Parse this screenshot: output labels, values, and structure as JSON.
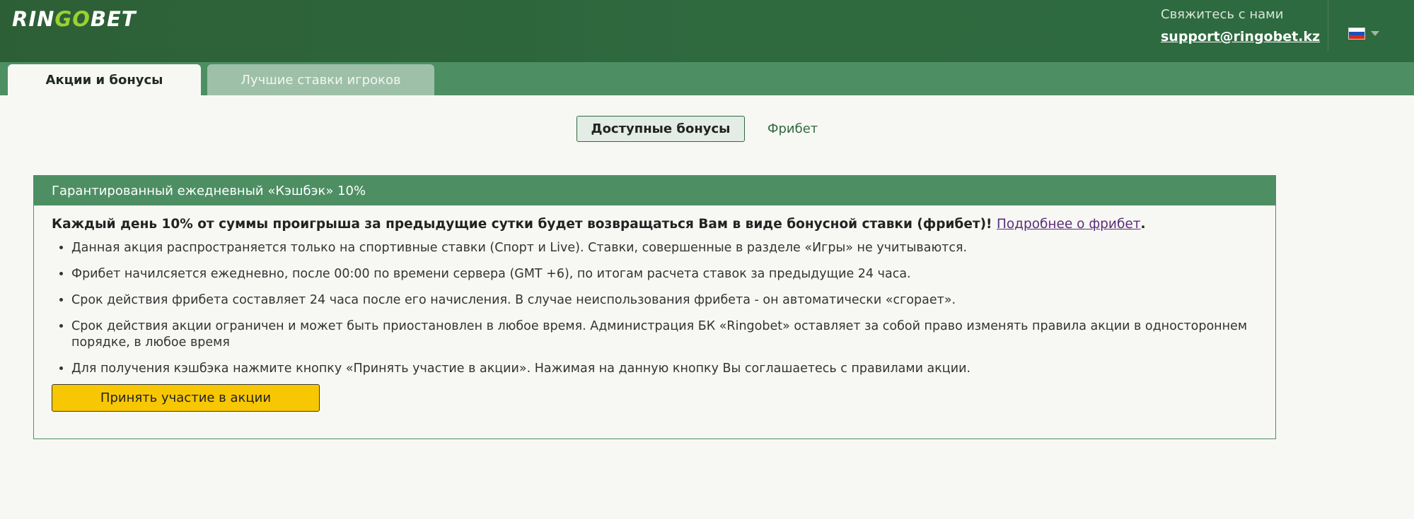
{
  "header": {
    "logo_text_1": "RIN",
    "logo_text_2": "GO",
    "logo_text_3": "BET",
    "contact_label": "Свяжитесь с нами",
    "contact_email": "support@ringobet.kz",
    "language_icon": "flag-ru-icon"
  },
  "tabs": [
    {
      "label": "Акции и бонусы",
      "active": true
    },
    {
      "label": "Лучшие ставки игроков",
      "active": false
    }
  ],
  "subtabs": [
    {
      "label": "Доступные бонусы",
      "active": true
    },
    {
      "label": "Фрибет",
      "active": false
    }
  ],
  "promo": {
    "title": "Гарантированный ежедневный «Кэшбэк» 10%",
    "lead": "Каждый день 10% от суммы проигрыша за предыдущие сутки будет возвращаться Вам в виде бонусной ставки (фрибет)! ",
    "lead_link": "Подробнее о фрибет",
    "lead_tail": ".",
    "rules": [
      "Данная акция распространяется только на спортивные ставки (Спорт и Live). Ставки, совершенные в разделе «Игры» не учитываются.",
      "Фрибет начилсяется ежедневно, после 00:00 по времени сервера (GMT +6), по итогам расчета ставок за предыдущие 24 часа.",
      "Срок действия фрибета составляет 24 часа после его начисления. В случае неиспользования фрибета - он автоматически «сгорает».",
      "Срок действия акции ограничен и может быть приостановлен в любое время. Администрация БК «Ringobet» оставляет за собой право изменять правила акции в одностороннем порядке, в любое время",
      "Для получения кэшбэка нажмите кнопку «Принять участие в акции». Нажимая на данную кнопку Вы соглашаетесь с правилами акции."
    ],
    "button_label": "Принять участие в акции"
  },
  "colors": {
    "header_green": "#2f6a3f",
    "tab_green": "#4d8f63",
    "accent_yellow": "#f7c704",
    "link_purple": "#5b2d7a"
  }
}
